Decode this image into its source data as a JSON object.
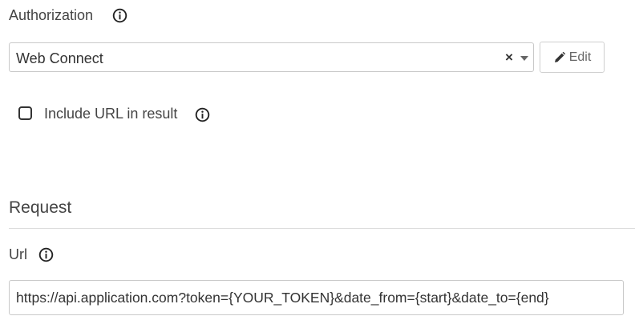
{
  "authorization": {
    "label": "Authorization",
    "selected_value": "Web Connect",
    "clear_symbol": "×",
    "edit_label": "Edit"
  },
  "include_url": {
    "label": "Include URL in result",
    "checked": false
  },
  "request": {
    "heading": "Request",
    "url_label": "Url",
    "url_value": "https://api.application.com?token={YOUR_TOKEN}&date_from={start}&date_to={end}"
  },
  "icons": {
    "info": "info-circle-icon",
    "pencil": "pencil-icon",
    "caret": "caret-down-icon",
    "clear": "clear-x-icon"
  },
  "colors": {
    "text": "#444444",
    "border": "#c9c9c9",
    "divider": "#dcdcdc"
  }
}
